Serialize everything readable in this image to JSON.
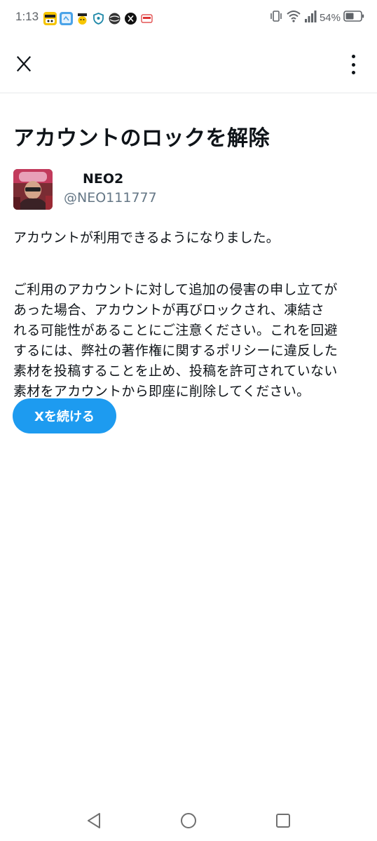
{
  "status_bar": {
    "time": "1:13",
    "battery": "54%",
    "notification_icons": [
      "news-app-icon",
      "weather-app-icon",
      "face-app-icon",
      "shield-app-icon",
      "globe-app-icon",
      "x-app-icon",
      "shop-app-icon"
    ],
    "system_icons": [
      "vibrate-icon",
      "wifi-icon",
      "signal-icon",
      "battery-icon"
    ]
  },
  "app_bar": {
    "logo": "x-logo-icon",
    "menu": "more-vertical-icon"
  },
  "main": {
    "title": "アカウントのロックを解除",
    "account": {
      "display_name": "NEO2",
      "username": "@NEO111777"
    },
    "message_lines": [
      "アカウントが利用できるようになりました。"
    ],
    "notice_lines": [
      "ご利用のアカウントに対して追加の侵害の申し立てが",
      "あった場合、アカウントが再びロックされ、凍結さ",
      "れる可能性があることにご注意ください。これを回避",
      "するには、弊社の著作権に関するポリシーに違反した",
      "素材を投稿することを止め、投稿を許可されていない",
      "素材をアカウントから即座に削除してください。"
    ],
    "continue_button": "Xを続ける"
  },
  "nav_bar": {
    "buttons": [
      "back-icon",
      "home-icon",
      "recents-icon"
    ]
  },
  "colors": {
    "accent": "#1d9bf0",
    "text": "#0f1419",
    "secondary_text": "#657786",
    "divider": "#e6e9eb",
    "background": "#ffffff"
  }
}
